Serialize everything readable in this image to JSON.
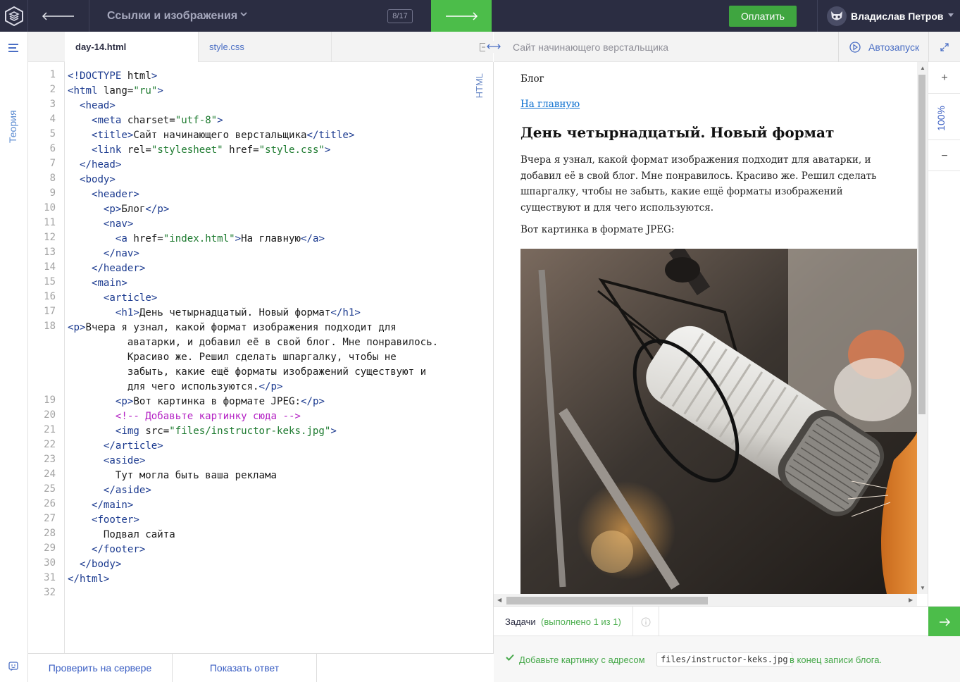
{
  "topbar": {
    "course_title": "Ссылки и изображения",
    "progress": "8/17",
    "pay_label": "Оплатить",
    "user_name": "Владислав Петров"
  },
  "sidebar": {
    "theory_label": "Теория"
  },
  "editor": {
    "tabs": [
      {
        "label": "day-14.html",
        "active": true
      },
      {
        "label": "style.css",
        "active": false
      }
    ],
    "language_label": "HTML",
    "line_numbers": [
      "1",
      "2",
      "3",
      "4",
      "5",
      "6",
      "7",
      "8",
      "9",
      "10",
      "11",
      "12",
      "13",
      "14",
      "15",
      "16",
      "17",
      "18",
      "19",
      "20",
      "21",
      "22",
      "23",
      "24",
      "25",
      "26",
      "27",
      "28",
      "29",
      "30",
      "31",
      "32"
    ],
    "code_lines": [
      "<!DOCTYPE html>",
      "<html lang=\"ru\">",
      "  <head>",
      "    <meta charset=\"utf-8\">",
      "    <title>Сайт начинающего верстальщика</title>",
      "    <link rel=\"stylesheet\" href=\"style.css\">",
      "  </head>",
      "  <body>",
      "    <header>",
      "      <p>Блог</p>",
      "      <nav>",
      "        <a href=\"index.html\">На главную</a>",
      "      </nav>",
      "    </header>",
      "    <main>",
      "      <article>",
      "        <h1>День четырнадцатый. Новый формат</h1>",
      "        <p>Вчера я узнал, какой формат изображения подходит для аватарки, и добавил её в свой блог. Мне понравилось. Красиво же. Решил сделать шпаргалку, чтобы не забыть, какие ещё форматы изображений существуют и для чего используются.</p>",
      "        <p>Вот картинка в формате JPEG:</p>",
      "        <!-- Добавьте картинку сюда -->",
      "        <img src=\"files/instructor-keks.jpg\">",
      "      </article>",
      "      <aside>",
      "        Тут могла быть ваша реклама",
      "      </aside>",
      "    </main>",
      "    <footer>",
      "      Подвал сайта",
      "    </footer>",
      "  </body>",
      "</html>",
      ""
    ],
    "check_button": "Проверить на сервере",
    "answer_button": "Показать ответ"
  },
  "preview": {
    "page_title": "Сайт начинающего верстальщика",
    "autorun_label": "Автозапуск",
    "zoom": "100%",
    "blog": "Блог",
    "home_link": "На главную",
    "heading": "День четырнадцатый. Новый формат",
    "paragraph": "Вчера я узнал, какой формат изображения подходит для аватарки, и добавил её в свой блог. Мне понравилось. Красиво же. Решил сделать шпаргалку, чтобы не забыть, какие ещё форматы изображений существуют и для чего используются.",
    "paragraph2": "Вот картинка в формате JPEG:"
  },
  "tasks": {
    "label": "Задачи",
    "progress": "(выполнено 1 из 1)",
    "task_text_before": "Добавьте картинку с адресом",
    "task_code": "files/instructor-keks.jpg",
    "task_text_after": "в конец записи блога."
  },
  "colors": {
    "topbar": "#2b2d42",
    "accent_green": "#4cbd4a",
    "link_blue": "#3a5ec3",
    "success_text": "#46a84a"
  },
  "icons": [
    "logo-icon",
    "back-arrow-icon",
    "chevron-down-icon",
    "forward-arrow-icon",
    "avatar-icon",
    "menu-icon",
    "feedback-icon",
    "collapse-icon",
    "swap-icon",
    "autorun-icon",
    "expand-icon",
    "info-icon",
    "check-icon"
  ]
}
